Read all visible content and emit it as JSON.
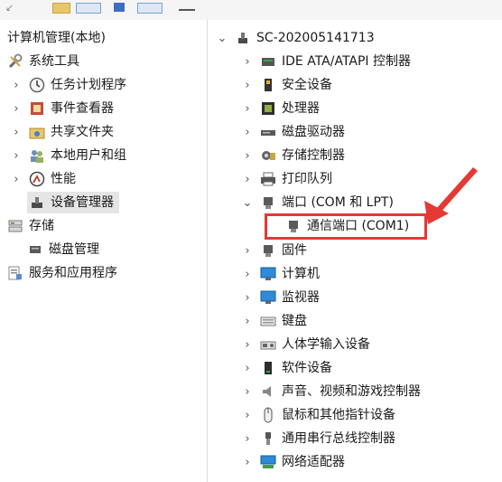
{
  "left_tree": {
    "root": "计算机管理(本地)",
    "system_tools": "系统工具",
    "task_scheduler": "任务计划程序",
    "event_viewer": "事件查看器",
    "shared_folders": "共享文件夹",
    "local_users": "本地用户和组",
    "performance": "性能",
    "device_manager": "设备管理器",
    "storage": "存储",
    "disk_management": "磁盘管理",
    "services_apps": "服务和应用程序"
  },
  "device_tree": {
    "computer_name": "SC-202005141713",
    "categories": {
      "ide": "IDE ATA/ATAPI 控制器",
      "security": "安全设备",
      "processor": "处理器",
      "disk_drives": "磁盘驱动器",
      "storage_ctrl": "存储控制器",
      "print_queue": "打印队列",
      "ports": "端口 (COM 和 LPT)",
      "port_com1": "通信端口 (COM1)",
      "firmware": "固件",
      "computer": "计算机",
      "monitors": "监视器",
      "keyboards": "键盘",
      "hid": "人体学输入设备",
      "software_devices": "软件设备",
      "audio": "声音、视频和游戏控制器",
      "mice": "鼠标和其他指针设备",
      "usb": "通用串行总线控制器",
      "network": "网络适配器"
    }
  },
  "colors": {
    "annotation": "#e53935",
    "selection": "#e5e5e5",
    "monitor_blue": "#2f8ad8"
  }
}
